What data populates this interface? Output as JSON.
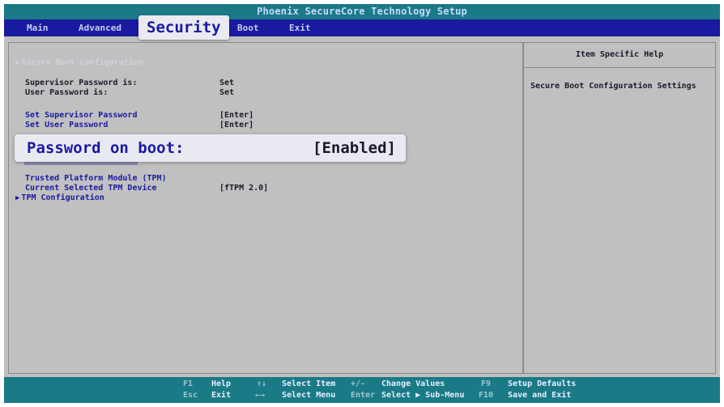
{
  "window": {
    "title": "Phoenix SecureCore Technology Setup"
  },
  "menu": {
    "items": [
      {
        "label": "Main"
      },
      {
        "label": "Advanced"
      },
      {
        "label": "Security",
        "active": true
      },
      {
        "label": "Boot"
      },
      {
        "label": "Exit"
      }
    ]
  },
  "settings": {
    "secure_boot": {
      "label": "Secure Boot Configuration",
      "icon": "triangle-right-icon"
    },
    "supervisor_status": {
      "label": "Supervisor Password is:",
      "value": "Set"
    },
    "user_status": {
      "label": "User Password is:",
      "value": "Set"
    },
    "set_supervisor": {
      "label": "Set Supervisor Password",
      "value": "[Enter]"
    },
    "set_user": {
      "label": "Set User Password",
      "value": "[Enter]"
    },
    "password_on_boot": {
      "label": "Password on boot:",
      "value": "[Enabled]"
    },
    "tpm_heading": {
      "label": "Trusted Platform Module (TPM)"
    },
    "tpm_device": {
      "label": "Current Selected TPM Device",
      "value": "[fTPM 2.0]"
    },
    "tpm_config": {
      "label": "TPM Configuration",
      "icon": "triangle-right-icon"
    }
  },
  "help": {
    "title": "Item Specific Help",
    "text": "Secure Boot Configuration Settings"
  },
  "footer": {
    "row1": [
      {
        "key": "F1",
        "desc": "Help"
      },
      {
        "key": "↑↓",
        "desc": "Select Item"
      },
      {
        "key": "+/-",
        "desc": "Change Values"
      },
      {
        "key": "F9",
        "desc": "Setup Defaults"
      }
    ],
    "row2": [
      {
        "key": "Esc",
        "desc": "Exit"
      },
      {
        "key": "←→",
        "desc": "Select Menu"
      },
      {
        "key": "Enter",
        "desc": "Select ▶ Sub-Menu"
      },
      {
        "key": "F10",
        "desc": "Save and Exit"
      }
    ]
  },
  "colors": {
    "title_bar": "#1a7a86",
    "menu_bar": "#1a1aa0",
    "background": "#c0c0c0",
    "highlight": "#e9e9f2"
  }
}
